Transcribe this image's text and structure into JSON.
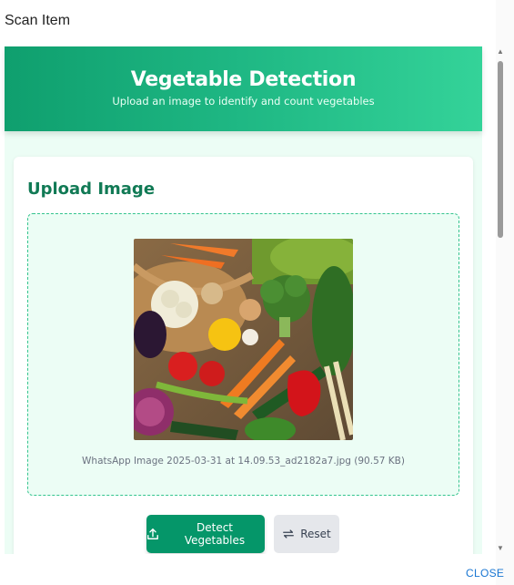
{
  "dialog": {
    "title": "Scan Item",
    "close_label": "CLOSE"
  },
  "hero": {
    "title": "Vegetable Detection",
    "subtitle": "Upload an image to identify and count vegetables"
  },
  "upload": {
    "title": "Upload Image",
    "file_name": "WhatsApp Image 2025-03-31 at 14.09.53_ad2182a7.jpg (90.57 KB)"
  },
  "actions": {
    "detect_label": "Detect Vegetables",
    "reset_label": "Reset"
  },
  "icons": {
    "detect": "upload-icon",
    "reset": "refresh-icon"
  },
  "colors": {
    "accent": "#059669",
    "hero_start": "#0f9f6e",
    "hero_end": "#34d399",
    "title_green": "#117a55",
    "link_blue": "#1976d2"
  }
}
